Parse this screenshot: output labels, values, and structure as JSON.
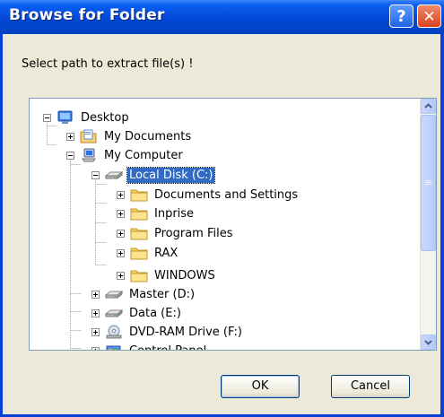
{
  "window": {
    "title": "Browse for Folder",
    "help_label": "?",
    "close_label": "✕"
  },
  "prompt": "Select path to extract file(s) !",
  "tree": {
    "items": [
      {
        "label": "Desktop",
        "icon": "desktop-icon",
        "expander": "minus"
      },
      {
        "label": "My Documents",
        "icon": "my-documents-icon",
        "expander": "plus"
      },
      {
        "label": "My Computer",
        "icon": "my-computer-icon",
        "expander": "minus"
      },
      {
        "label": "Local Disk (C:)",
        "icon": "hard-drive-icon",
        "expander": "minus",
        "selected": true
      },
      {
        "label": "Documents and Settings",
        "icon": "folder-icon",
        "expander": "plus"
      },
      {
        "label": "Inprise",
        "icon": "folder-icon",
        "expander": "plus"
      },
      {
        "label": "Program Files",
        "icon": "folder-icon",
        "expander": "plus"
      },
      {
        "label": "RAX",
        "icon": "folder-icon",
        "expander": "plus"
      },
      {
        "label": "WINDOWS",
        "icon": "folder-icon",
        "expander": "plus"
      },
      {
        "label": "Master (D:)",
        "icon": "hard-drive-icon",
        "expander": "plus"
      },
      {
        "label": "Data (E:)",
        "icon": "hard-drive-icon",
        "expander": "plus"
      },
      {
        "label": "DVD-RAM Drive (F:)",
        "icon": "dvd-drive-icon",
        "expander": "plus"
      },
      {
        "label": "Control Panel",
        "icon": "control-panel-icon",
        "expander": "plus"
      }
    ]
  },
  "buttons": {
    "ok": "OK",
    "cancel": "Cancel"
  },
  "colors": {
    "titlebar": "#0348d6",
    "client": "#ece9d8",
    "selection": "#316ac5"
  }
}
